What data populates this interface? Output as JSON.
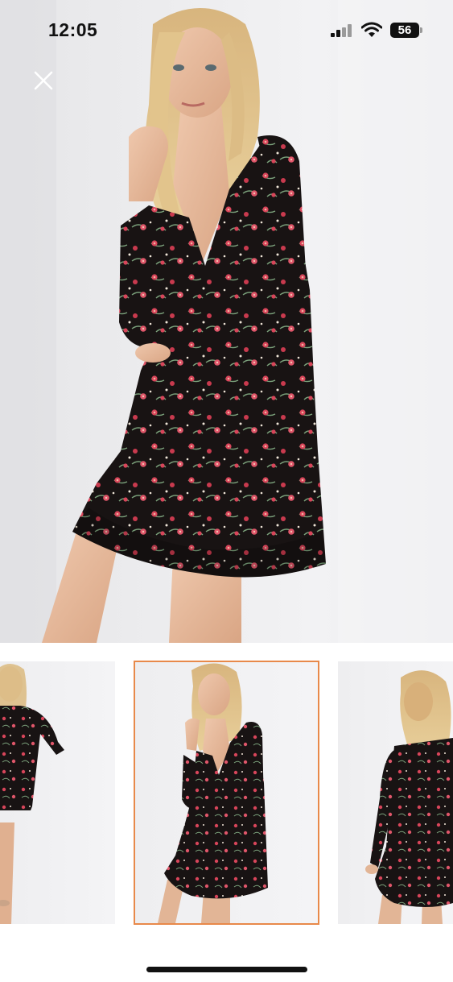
{
  "status_bar": {
    "time": "12:05",
    "battery_level": "56",
    "icons": [
      "signal-icon",
      "wifi-icon",
      "battery-icon"
    ]
  },
  "viewer": {
    "close_icon": "close-icon",
    "selected_thumbnail_index": 1,
    "thumbnail_count": 3
  },
  "colors": {
    "accent_border": "#e8894a",
    "dress_base": "#1a1414",
    "flower": "#d8455a",
    "leaf": "#7aa07a"
  }
}
